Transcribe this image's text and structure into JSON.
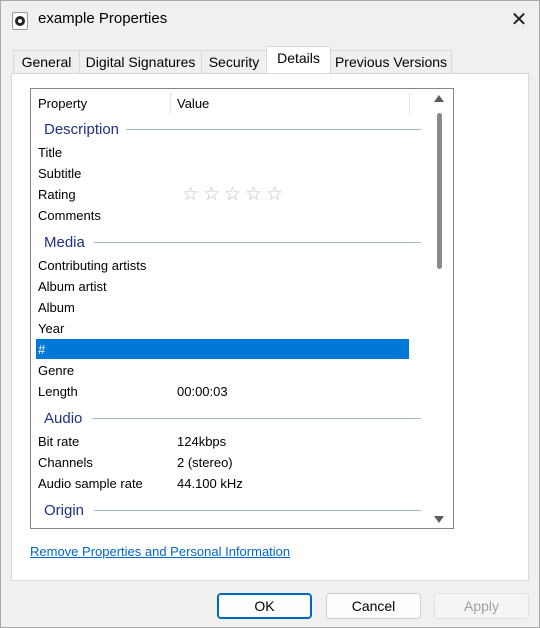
{
  "window": {
    "title": "example Properties",
    "close_glyph": "✕"
  },
  "tabs": [
    {
      "label": "General",
      "active": false
    },
    {
      "label": "Digital Signatures",
      "active": false
    },
    {
      "label": "Security",
      "active": false
    },
    {
      "label": "Details",
      "active": true
    },
    {
      "label": "Previous Versions",
      "active": false
    }
  ],
  "list": {
    "header": {
      "property": "Property",
      "value": "Value"
    },
    "groups": {
      "description": "Description",
      "media": "Media",
      "audio": "Audio",
      "origin": "Origin"
    },
    "description_rows": [
      {
        "name": "Title",
        "value": ""
      },
      {
        "name": "Subtitle",
        "value": ""
      },
      {
        "name": "Rating",
        "value": ""
      },
      {
        "name": "Comments",
        "value": ""
      }
    ],
    "media_rows": [
      {
        "name": "Contributing artists",
        "value": ""
      },
      {
        "name": "Album artist",
        "value": ""
      },
      {
        "name": "Album",
        "value": ""
      },
      {
        "name": "Year",
        "value": ""
      },
      {
        "name": "#",
        "value": "",
        "selected": true
      },
      {
        "name": "Genre",
        "value": ""
      },
      {
        "name": "Length",
        "value": "00:00:03"
      }
    ],
    "audio_rows": [
      {
        "name": "Bit rate",
        "value": "124kbps"
      },
      {
        "name": "Channels",
        "value": "2 (stereo)"
      },
      {
        "name": "Audio sample rate",
        "value": "44.100 kHz"
      }
    ],
    "rating": {
      "stars": 5,
      "filled": 0,
      "star_glyph": "☆"
    }
  },
  "link_text": "Remove Properties and Personal Information",
  "buttons": {
    "ok": "OK",
    "cancel": "Cancel",
    "apply": "Apply"
  },
  "colors": {
    "selection": "#0078d7",
    "group_header": "#1e3287",
    "link": "#0066cc"
  }
}
